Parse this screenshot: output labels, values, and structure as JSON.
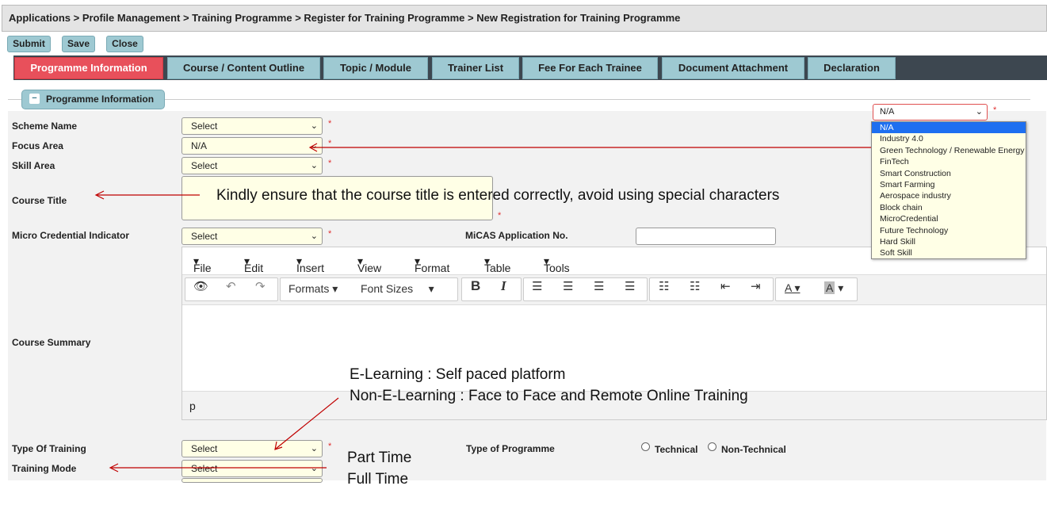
{
  "breadcrumb": "Applications  > Profile Management  > Training Programme  > Register for Training Programme  > New Registration for Training Programme",
  "toolbar": {
    "submit": "Submit",
    "save": "Save",
    "close": "Close"
  },
  "tabs": [
    "Programme Information",
    "Course / Content Outline",
    "Topic / Module",
    "Trainer List",
    "Fee For Each Trainee",
    "Document Attachment",
    "Declaration"
  ],
  "section_title": "Programme Information",
  "form": {
    "scheme_name": {
      "label": "Scheme Name",
      "value": "Select"
    },
    "focus_area": {
      "label": "Focus Area",
      "value": "N/A"
    },
    "skill_area": {
      "label": "Skill Area",
      "value": "Select"
    },
    "course_title": {
      "label": "Course Title"
    },
    "micro_credential": {
      "label": "Micro Credential Indicator",
      "value": "Select"
    },
    "micas": {
      "label": "MiCAS Application No."
    },
    "course_summary": {
      "label": "Course Summary"
    },
    "type_of_training": {
      "label": "Type Of Training",
      "value": "Select"
    },
    "training_mode": {
      "label": "Training Mode",
      "value": "Select"
    },
    "type_of_programme": {
      "label": "Type of Programme",
      "opt1": "Technical",
      "opt2": "Non-Technical"
    },
    "required": "*"
  },
  "editor": {
    "menu": [
      "File",
      "Edit",
      "Insert",
      "View",
      "Format",
      "Table",
      "Tools"
    ],
    "formats": "Formats",
    "font_sizes": "Font Sizes",
    "status_path": "p"
  },
  "dropdown": {
    "selected": "N/A",
    "options": [
      "N/A",
      "Industry 4.0",
      "Green Technology / Renewable Energy",
      "FinTech",
      "Smart Construction",
      "Smart Farming",
      "Aerospace industry",
      "Block chain",
      "MicroCredential",
      "Future Technology",
      "Hard Skill",
      "Soft Skill"
    ]
  },
  "annotations": {
    "course_title_note": "Kindly ensure that the course title is entered correctly, avoid using special characters",
    "elearning": "E-Learning : Self paced platform",
    "non_elearning": "Non-E-Learning : Face to Face and Remote Online Training",
    "part_time": "Part Time",
    "full_time": "Full Time"
  },
  "colors": {
    "active_tab": "#e8505b",
    "tab": "#9ec9d2",
    "field_bg": "#ffffe6",
    "arrow": "#c00000",
    "selected_option": "#1e6ff0"
  }
}
